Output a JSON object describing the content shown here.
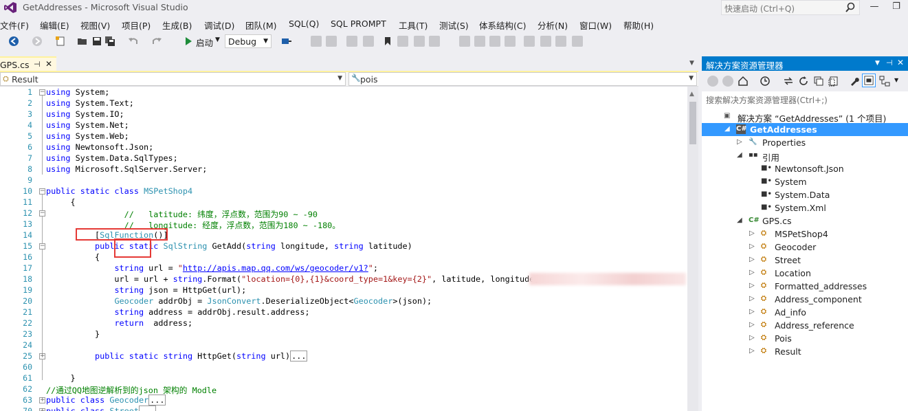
{
  "window": {
    "title": "GetAddresses - Microsoft Visual Studio",
    "quick_launch": "快速启动 (Ctrl+Q)"
  },
  "menu": [
    "文件(F)",
    "编辑(E)",
    "视图(V)",
    "项目(P)",
    "生成(B)",
    "调试(D)",
    "团队(M)",
    "SQL(Q)",
    "SQL PROMPT",
    "工具(T)",
    "测试(S)",
    "体系结构(C)",
    "分析(N)",
    "窗口(W)",
    "帮助(H)"
  ],
  "toolbar": {
    "start_label": "启动",
    "config": "Debug"
  },
  "editor": {
    "tab": "GPS.cs",
    "nav_left": "Result",
    "nav_right": "pois",
    "lines": [
      {
        "n": "1",
        "html": "<span class=\"kw\">using</span> System;"
      },
      {
        "n": "2",
        "html": "<span class=\"kw\">using</span> System.Text;"
      },
      {
        "n": "3",
        "html": "<span class=\"kw\">using</span> System.IO;"
      },
      {
        "n": "4",
        "html": "<span class=\"kw\">using</span> System.Net;"
      },
      {
        "n": "5",
        "html": "<span class=\"kw\">using</span> System.Web;"
      },
      {
        "n": "6",
        "html": "<span class=\"kw\">using</span> Newtonsoft.Json;"
      },
      {
        "n": "7",
        "html": "<span class=\"kw\">using</span> System.Data.SqlTypes;"
      },
      {
        "n": "8",
        "html": "<span class=\"kw\">using</span> Microsoft.SqlServer.Server;"
      },
      {
        "n": "9",
        "html": ""
      },
      {
        "n": "10",
        "html": "<span class=\"kw\">public static class</span> <span class=\"ty\">MSPetShop4</span>"
      },
      {
        "n": "11",
        "html": "     {"
      },
      {
        "n": "12",
        "html": "                <span class=\"cm\">//   latitude: 纬度，浮点数，范围为90 ~ -90</span>"
      },
      {
        "n": "13",
        "html": "                <span class=\"cm\">//   longitude: 经度，浮点数，范围为180 ~ -180。</span>"
      },
      {
        "n": "14",
        "html": "          [<span class=\"ty\">SqlFunction</span>()]"
      },
      {
        "n": "15",
        "html": "          <span class=\"kw\">public static</span> <span class=\"ty\">SqlString</span> GetAdd(<span class=\"kw\">string</span> longitude, <span class=\"kw\">string</span> latitude)"
      },
      {
        "n": "16",
        "html": "          {"
      },
      {
        "n": "17",
        "html": "              <span class=\"kw\">string</span> url = <span class=\"st\">\"</span><span class=\"url\">http://apis.map.qq.com/ws/geocoder/v1?</span><span class=\"st\">\"</span>;"
      },
      {
        "n": "18",
        "html": "              url = url + <span class=\"kw\">string</span>.Format(<span class=\"st\">\"location={0},{1}&amp;coord_type=1&amp;key={2}\"</span>, latitude, longitude,"
      },
      {
        "n": "19",
        "html": "              <span class=\"kw\">string</span> json = HttpGet(url);"
      },
      {
        "n": "20",
        "html": "              <span class=\"ty\">Geocoder</span> addrObj = <span class=\"ty\">JsonConvert</span>.DeserializeObject&lt;<span class=\"ty\">Geocoder</span>&gt;(json);"
      },
      {
        "n": "21",
        "html": "              <span class=\"kw\">string</span> address = addrObj.result.address;"
      },
      {
        "n": "22",
        "html": "              <span class=\"kw\">return</span>  address;"
      },
      {
        "n": "23",
        "html": "          }"
      },
      {
        "n": "24",
        "html": ""
      },
      {
        "n": "25",
        "html": "          <span class=\"kw\">public static string</span> HttpGet(<span class=\"kw\">string</span> url)<span class=\"collapsed\">...</span>"
      },
      {
        "n": "60",
        "html": ""
      },
      {
        "n": "61",
        "html": "     }"
      },
      {
        "n": "62",
        "html": "<span class=\"cm\">//通过QQ地图逆解析到的json 架构的 Modle</span>"
      },
      {
        "n": "63",
        "html": "<span class=\"kw\">public class</span> <span class=\"ty\">Geocoder</span><span class=\"collapsed\">...</span>"
      },
      {
        "n": "70",
        "html": "<span class=\"kw\">public class</span> <span class=\"ty\">Street</span><span class=\"collapsed\">...</span>"
      }
    ]
  },
  "solution_explorer": {
    "title": "解决方案资源管理器",
    "search_placeholder": "搜索解决方案资源管理器(Ctrl+;)",
    "items": [
      {
        "label": "解决方案 “GetAddresses” (1 个项目)",
        "icon": "solution-icon"
      },
      {
        "label": "GetAddresses",
        "icon": "csharp-project-icon"
      },
      {
        "label": "Properties",
        "icon": "wrench-icon"
      },
      {
        "label": "引用",
        "icon": "references-icon"
      },
      {
        "label": "Newtonsoft.Json",
        "icon": "assembly-icon"
      },
      {
        "label": "System",
        "icon": "assembly-icon"
      },
      {
        "label": "System.Data",
        "icon": "assembly-icon"
      },
      {
        "label": "System.Xml",
        "icon": "assembly-icon"
      },
      {
        "label": "GPS.cs",
        "icon": "csharp-file-icon"
      },
      {
        "label": "MSPetShop4",
        "icon": "class-icon"
      },
      {
        "label": "Geocoder",
        "icon": "class-icon"
      },
      {
        "label": "Street",
        "icon": "class-icon"
      },
      {
        "label": "Location",
        "icon": "class-icon"
      },
      {
        "label": "Formatted_addresses",
        "icon": "class-icon"
      },
      {
        "label": "Address_component",
        "icon": "class-icon"
      },
      {
        "label": "Ad_info",
        "icon": "class-icon"
      },
      {
        "label": "Address_reference",
        "icon": "class-icon"
      },
      {
        "label": "Pois",
        "icon": "class-icon"
      },
      {
        "label": "Result",
        "icon": "class-icon"
      }
    ]
  },
  "colors": {
    "accent": "#007acc",
    "selection": "#3399ff",
    "keyword": "#0000ff",
    "type": "#2b91af",
    "comment": "#008000",
    "string": "#a31515",
    "highlight_box": "#e53935"
  }
}
